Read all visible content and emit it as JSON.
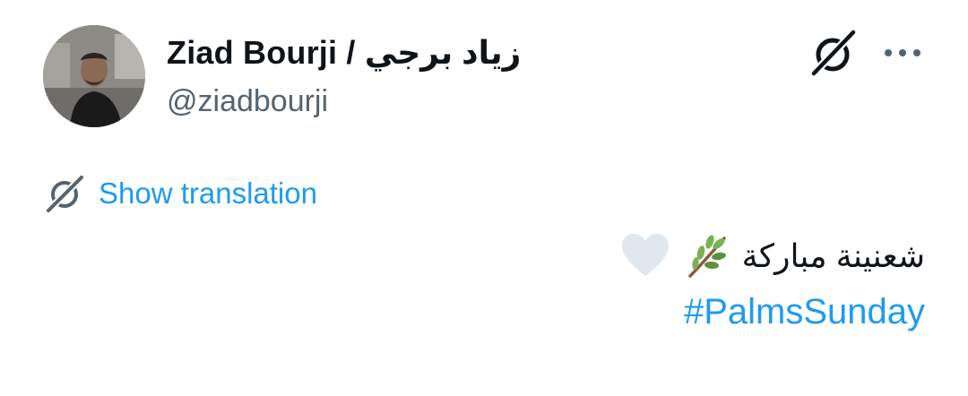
{
  "author": {
    "display_name": "Ziad Bourji / زياد برجي",
    "handle": "@ziadbourji",
    "avatar_icon": "user-avatar-photo"
  },
  "actions": {
    "grok_icon": "grok-icon",
    "more_icon": "more-horizontal-icon"
  },
  "translation": {
    "icon": "grok-translate-icon",
    "label": "Show translation"
  },
  "tweet": {
    "text": "شعنينة مباركة",
    "emojis": [
      "palm-branch-emoji",
      "white-heart-emoji"
    ],
    "hashtag": "#PalmsSunday"
  },
  "colors": {
    "link": "#1d9bf0",
    "text": "#0f1419",
    "secondary": "#536471"
  }
}
